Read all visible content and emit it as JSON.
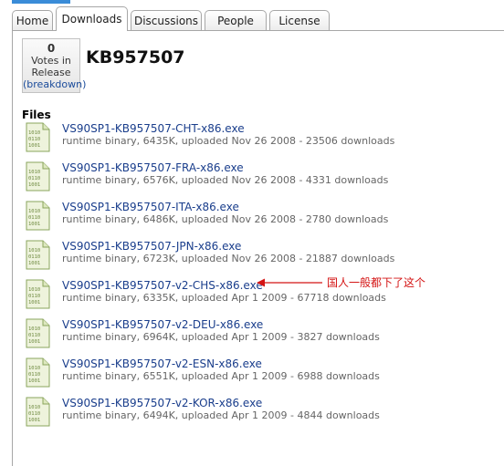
{
  "tabs": [
    {
      "label": "Home",
      "active": false
    },
    {
      "label": "Downloads",
      "active": true
    },
    {
      "label": "Discussions",
      "active": false
    },
    {
      "label": "People",
      "active": false
    },
    {
      "label": "License",
      "active": false
    }
  ],
  "votes": {
    "count": "0",
    "label_line1": "Votes in",
    "label_line2": "Release",
    "breakdown_link": "(breakdown)"
  },
  "release": {
    "title": "KB957507"
  },
  "files": {
    "heading": "Files",
    "items": [
      {
        "name": "VS90SP1-KB957507-CHT-x86.exe",
        "meta": "runtime binary, 6435K, uploaded Nov 26 2008 - 23506 downloads"
      },
      {
        "name": "VS90SP1-KB957507-FRA-x86.exe",
        "meta": "runtime binary, 6576K, uploaded Nov 26 2008 - 4331 downloads"
      },
      {
        "name": "VS90SP1-KB957507-ITA-x86.exe",
        "meta": "runtime binary, 6486K, uploaded Nov 26 2008 - 2780 downloads"
      },
      {
        "name": "VS90SP1-KB957507-JPN-x86.exe",
        "meta": "runtime binary, 6723K, uploaded Nov 26 2008 - 21887 downloads"
      },
      {
        "name": "VS90SP1-KB957507-v2-CHS-x86.exe",
        "meta": "runtime binary, 6335K, uploaded Apr 1 2009 - 67718 downloads"
      },
      {
        "name": "VS90SP1-KB957507-v2-DEU-x86.exe",
        "meta": "runtime binary, 6964K, uploaded Apr 1 2009 - 3827 downloads"
      },
      {
        "name": "VS90SP1-KB957507-v2-ESN-x86.exe",
        "meta": "runtime binary, 6551K, uploaded Apr 1 2009 - 6988 downloads"
      },
      {
        "name": "VS90SP1-KB957507-v2-KOR-x86.exe",
        "meta": "runtime binary, 6494K, uploaded Apr 1 2009 - 4844 downloads"
      }
    ]
  },
  "annotation": {
    "text": "国人一般都下了这个",
    "color": "#d41414"
  },
  "icons": {
    "file": "binary-file-icon"
  },
  "colors": {
    "link": "#1a3e8c",
    "tab_border": "#a7a7a7",
    "accent": "#3a8cd8"
  }
}
